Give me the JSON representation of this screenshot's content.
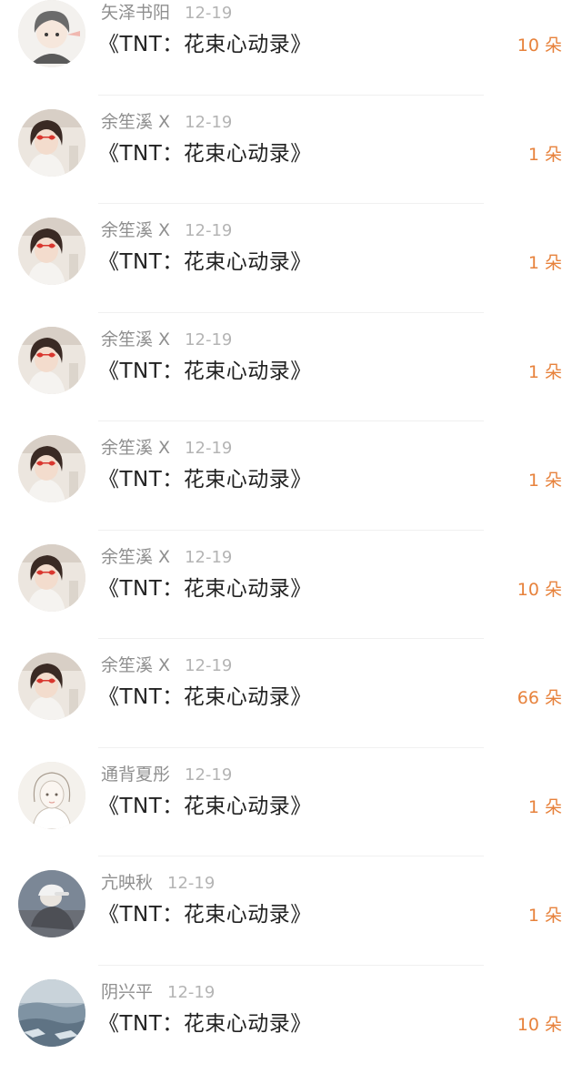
{
  "gift_list": {
    "colors": {
      "count_accent": "#e7823c",
      "name": "#8f8f8f",
      "date": "#b4b4b4",
      "title": "#222222"
    },
    "items": [
      {
        "name": "矢泽书阳",
        "date": "12-19",
        "title": "《TNT：花束心动录》",
        "count": "10 朵",
        "avatar": "cartoon-girl-avatar"
      },
      {
        "name": "余笙溪 X",
        "date": "12-19",
        "title": "《TNT：花束心动录》",
        "count": "1 朵",
        "avatar": "girl-with-heart-glasses-avatar"
      },
      {
        "name": "余笙溪 X",
        "date": "12-19",
        "title": "《TNT：花束心动录》",
        "count": "1 朵",
        "avatar": "girl-with-heart-glasses-avatar"
      },
      {
        "name": "余笙溪 X",
        "date": "12-19",
        "title": "《TNT：花束心动录》",
        "count": "1 朵",
        "avatar": "girl-with-heart-glasses-avatar"
      },
      {
        "name": "余笙溪 X",
        "date": "12-19",
        "title": "《TNT：花束心动录》",
        "count": "1 朵",
        "avatar": "girl-with-heart-glasses-avatar"
      },
      {
        "name": "余笙溪 X",
        "date": "12-19",
        "title": "《TNT：花束心动录》",
        "count": "10 朵",
        "avatar": "girl-with-heart-glasses-avatar"
      },
      {
        "name": "余笙溪 X",
        "date": "12-19",
        "title": "《TNT：花束心动录》",
        "count": "66 朵",
        "avatar": "girl-with-heart-glasses-avatar"
      },
      {
        "name": "通背夏彤",
        "date": "12-19",
        "title": "《TNT：花束心动录》",
        "count": "1 朵",
        "avatar": "sketch-girl-avatar"
      },
      {
        "name": "亢映秋",
        "date": "12-19",
        "title": "《TNT：花束心动录》",
        "count": "1 朵",
        "avatar": "person-in-cap-avatar"
      },
      {
        "name": "阴兴平",
        "date": "12-19",
        "title": "《TNT：花束心动录》",
        "count": "10 朵",
        "avatar": "icy-landscape-avatar"
      }
    ]
  }
}
